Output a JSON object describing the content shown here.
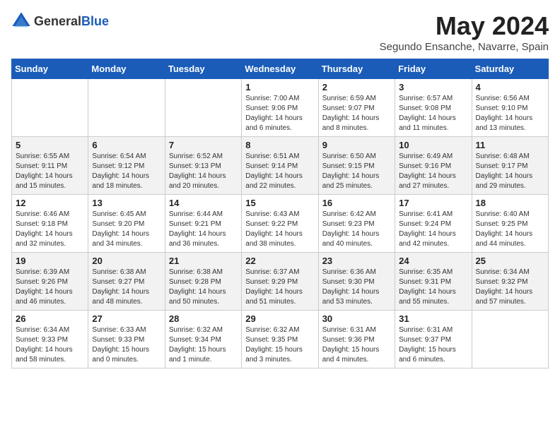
{
  "header": {
    "logo_general": "General",
    "logo_blue": "Blue",
    "month_title": "May 2024",
    "location": "Segundo Ensanche, Navarre, Spain"
  },
  "days_of_week": [
    "Sunday",
    "Monday",
    "Tuesday",
    "Wednesday",
    "Thursday",
    "Friday",
    "Saturday"
  ],
  "weeks": [
    [
      {
        "day": "",
        "info": ""
      },
      {
        "day": "",
        "info": ""
      },
      {
        "day": "",
        "info": ""
      },
      {
        "day": "1",
        "info": "Sunrise: 7:00 AM\nSunset: 9:06 PM\nDaylight: 14 hours\nand 6 minutes."
      },
      {
        "day": "2",
        "info": "Sunrise: 6:59 AM\nSunset: 9:07 PM\nDaylight: 14 hours\nand 8 minutes."
      },
      {
        "day": "3",
        "info": "Sunrise: 6:57 AM\nSunset: 9:08 PM\nDaylight: 14 hours\nand 11 minutes."
      },
      {
        "day": "4",
        "info": "Sunrise: 6:56 AM\nSunset: 9:10 PM\nDaylight: 14 hours\nand 13 minutes."
      }
    ],
    [
      {
        "day": "5",
        "info": "Sunrise: 6:55 AM\nSunset: 9:11 PM\nDaylight: 14 hours\nand 15 minutes."
      },
      {
        "day": "6",
        "info": "Sunrise: 6:54 AM\nSunset: 9:12 PM\nDaylight: 14 hours\nand 18 minutes."
      },
      {
        "day": "7",
        "info": "Sunrise: 6:52 AM\nSunset: 9:13 PM\nDaylight: 14 hours\nand 20 minutes."
      },
      {
        "day": "8",
        "info": "Sunrise: 6:51 AM\nSunset: 9:14 PM\nDaylight: 14 hours\nand 22 minutes."
      },
      {
        "day": "9",
        "info": "Sunrise: 6:50 AM\nSunset: 9:15 PM\nDaylight: 14 hours\nand 25 minutes."
      },
      {
        "day": "10",
        "info": "Sunrise: 6:49 AM\nSunset: 9:16 PM\nDaylight: 14 hours\nand 27 minutes."
      },
      {
        "day": "11",
        "info": "Sunrise: 6:48 AM\nSunset: 9:17 PM\nDaylight: 14 hours\nand 29 minutes."
      }
    ],
    [
      {
        "day": "12",
        "info": "Sunrise: 6:46 AM\nSunset: 9:18 PM\nDaylight: 14 hours\nand 32 minutes."
      },
      {
        "day": "13",
        "info": "Sunrise: 6:45 AM\nSunset: 9:20 PM\nDaylight: 14 hours\nand 34 minutes."
      },
      {
        "day": "14",
        "info": "Sunrise: 6:44 AM\nSunset: 9:21 PM\nDaylight: 14 hours\nand 36 minutes."
      },
      {
        "day": "15",
        "info": "Sunrise: 6:43 AM\nSunset: 9:22 PM\nDaylight: 14 hours\nand 38 minutes."
      },
      {
        "day": "16",
        "info": "Sunrise: 6:42 AM\nSunset: 9:23 PM\nDaylight: 14 hours\nand 40 minutes."
      },
      {
        "day": "17",
        "info": "Sunrise: 6:41 AM\nSunset: 9:24 PM\nDaylight: 14 hours\nand 42 minutes."
      },
      {
        "day": "18",
        "info": "Sunrise: 6:40 AM\nSunset: 9:25 PM\nDaylight: 14 hours\nand 44 minutes."
      }
    ],
    [
      {
        "day": "19",
        "info": "Sunrise: 6:39 AM\nSunset: 9:26 PM\nDaylight: 14 hours\nand 46 minutes."
      },
      {
        "day": "20",
        "info": "Sunrise: 6:38 AM\nSunset: 9:27 PM\nDaylight: 14 hours\nand 48 minutes."
      },
      {
        "day": "21",
        "info": "Sunrise: 6:38 AM\nSunset: 9:28 PM\nDaylight: 14 hours\nand 50 minutes."
      },
      {
        "day": "22",
        "info": "Sunrise: 6:37 AM\nSunset: 9:29 PM\nDaylight: 14 hours\nand 51 minutes."
      },
      {
        "day": "23",
        "info": "Sunrise: 6:36 AM\nSunset: 9:30 PM\nDaylight: 14 hours\nand 53 minutes."
      },
      {
        "day": "24",
        "info": "Sunrise: 6:35 AM\nSunset: 9:31 PM\nDaylight: 14 hours\nand 55 minutes."
      },
      {
        "day": "25",
        "info": "Sunrise: 6:34 AM\nSunset: 9:32 PM\nDaylight: 14 hours\nand 57 minutes."
      }
    ],
    [
      {
        "day": "26",
        "info": "Sunrise: 6:34 AM\nSunset: 9:33 PM\nDaylight: 14 hours\nand 58 minutes."
      },
      {
        "day": "27",
        "info": "Sunrise: 6:33 AM\nSunset: 9:33 PM\nDaylight: 15 hours\nand 0 minutes."
      },
      {
        "day": "28",
        "info": "Sunrise: 6:32 AM\nSunset: 9:34 PM\nDaylight: 15 hours\nand 1 minute."
      },
      {
        "day": "29",
        "info": "Sunrise: 6:32 AM\nSunset: 9:35 PM\nDaylight: 15 hours\nand 3 minutes."
      },
      {
        "day": "30",
        "info": "Sunrise: 6:31 AM\nSunset: 9:36 PM\nDaylight: 15 hours\nand 4 minutes."
      },
      {
        "day": "31",
        "info": "Sunrise: 6:31 AM\nSunset: 9:37 PM\nDaylight: 15 hours\nand 6 minutes."
      },
      {
        "day": "",
        "info": ""
      }
    ]
  ]
}
